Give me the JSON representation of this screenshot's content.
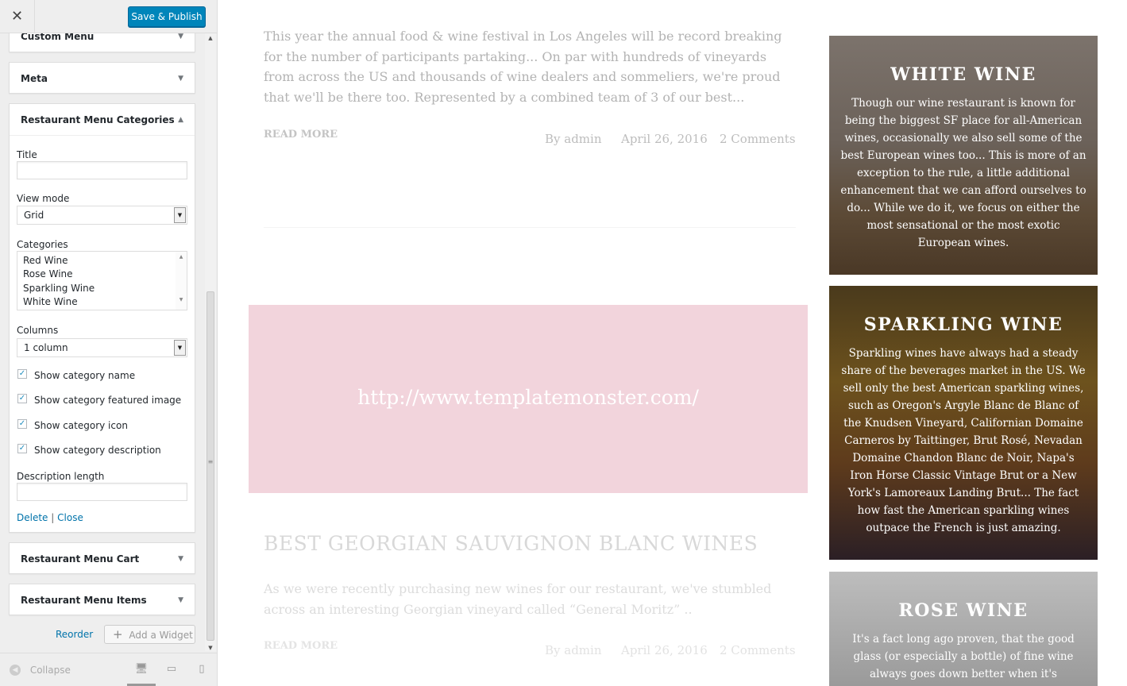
{
  "sidebar": {
    "close_icon": "close-icon",
    "save_label": "Save & Publish",
    "widgets": {
      "custom_menu": "Custom Menu",
      "meta": "Meta",
      "categories_widget": "Restaurant Menu Categories",
      "cart": "Restaurant Menu Cart",
      "items": "Restaurant Menu Items"
    },
    "form": {
      "title_label": "Title",
      "title_value": "",
      "view_mode_label": "View mode",
      "view_mode_value": "Grid",
      "categories_label": "Categories",
      "categories": [
        "Red Wine",
        "Rose Wine",
        "Sparkling Wine",
        "White Wine"
      ],
      "columns_label": "Columns",
      "columns_value": "1 column",
      "checkboxes": [
        {
          "label": "Show category name",
          "checked": true
        },
        {
          "label": "Show category featured image",
          "checked": true
        },
        {
          "label": "Show category icon",
          "checked": true
        },
        {
          "label": "Show category description",
          "checked": true
        }
      ],
      "desc_length_label": "Description length",
      "desc_length_value": "",
      "delete_label": "Delete",
      "separator": "|",
      "close_label": "Close"
    },
    "reorder_label": "Reorder",
    "add_widget_label": "Add a Widget",
    "collapse_label": "Collapse"
  },
  "preview": {
    "post1": {
      "excerpt": "This year the annual food & wine festival in Los Angeles will be record breaking for the number of participants partaking... On par with hundreds of vineyards from across the US and thousands of wine dealers and sommeliers, we're proud that we'll be there too. Represented by a combined team of 3 of our best...",
      "read_more": "READ MORE",
      "author": "By admin",
      "date": "April 26, 2016",
      "comments": "2 Comments"
    },
    "banner_url": "http://www.templatemonster.com/",
    "post2": {
      "title": "BEST GEORGIAN SAUVIGNON BLANC WINES",
      "excerpt": "As we were recently purchasing new wines for our restaurant, we've stumbled across an interesting Georgian vineyard called “General Moritz” ..",
      "read_more": "READ MORE",
      "author": "By admin",
      "date": "April 26, 2016",
      "comments": "2 Comments"
    },
    "cards": [
      {
        "title": "WHITE WINE",
        "text": "Though our wine restaurant is known for being the biggest SF place for all-American wines, occasionally we also sell some of the best European wines too... This is more of an exception to the rule, a little additional enhancement that we can afford ourselves to do... While we do it, we focus on either the most sensational or the most exotic European wines."
      },
      {
        "title": "SPARKLING WINE",
        "text": "Sparkling wines have always had a steady share of the beverages market in the US. We sell only the best American sparkling wines, such as Oregon's Argyle Blanc de Blanc of the Knudsen Vineyard, Californian Domaine Carneros by Taittinger, Brut Rosé, Nevadan Domaine Chandon Blanc de Noir, Napa's Iron Horse Classic Vintage Brut or a New York's Lamoreaux Landing Brut... The fact how fast the American sparkling wines outpace the French is just amazing."
      },
      {
        "title": "ROSE WINE",
        "text": "It's a fact long ago proven, that the good glass (or especially a bottle) of fine wine always goes down better when it's accompanied by some"
      }
    ]
  },
  "colors": {
    "accent": "#0085ba",
    "link": "#0073aa",
    "banner": "#f2d4dc"
  }
}
